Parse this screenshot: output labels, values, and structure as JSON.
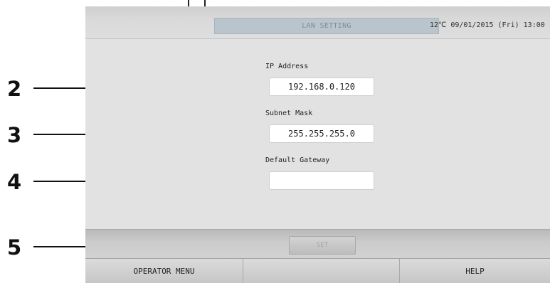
{
  "header": {
    "title": "LAN SETTING",
    "temperature": "12℃",
    "datetime": "09/01/2015 (Fri) 13:00"
  },
  "fields": {
    "ip_label": "IP Address",
    "ip_value": "192.168.0.120",
    "subnet_label": "Subnet Mask",
    "subnet_value": "255.255.255.0",
    "gateway_label": "Default Gateway",
    "gateway_value": ""
  },
  "actions": {
    "set_label": "SET"
  },
  "menu": {
    "operator_label": "OPERATOR MENU",
    "middle_label": "",
    "help_label": "HELP"
  },
  "callouts": [
    "2",
    "3",
    "4",
    "5"
  ]
}
